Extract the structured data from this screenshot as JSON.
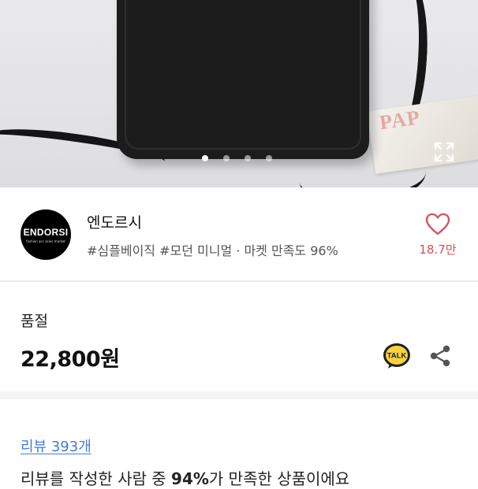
{
  "gallery": {
    "slide_count": 4,
    "active_slide": 1,
    "magazine_text": "PAP"
  },
  "store": {
    "logo_text": "ENDORSI",
    "logo_subtext": "fashion acc selec market",
    "name": "엔도르시",
    "tags": "#심플베이직 #모던 미니멀 · 마켓 만족도 96%",
    "like_count": "18.7만"
  },
  "product": {
    "status": "품절",
    "price": "22,800원",
    "talk_label": "TALK"
  },
  "reviews": {
    "link": "리뷰 393개",
    "summary_prefix": "리뷰를 작성한 사람 중 ",
    "summary_percent": "94%",
    "summary_suffix": "가 만족한 상품이에요"
  },
  "colors": {
    "like": "#d4525a",
    "link": "#3f7ed6",
    "talk_badge": "#f5d33d"
  }
}
